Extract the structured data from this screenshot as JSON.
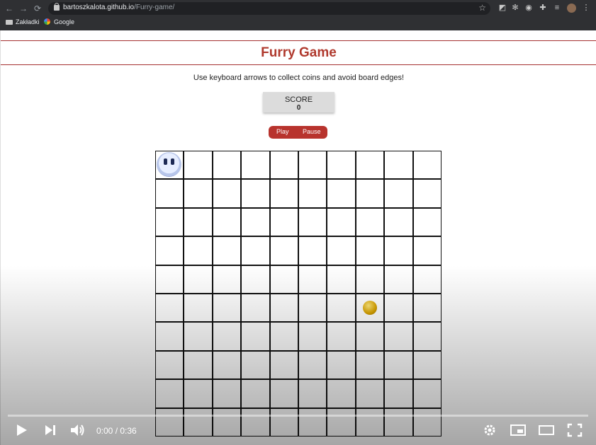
{
  "browser": {
    "url_host": "bartoszkalota.github.io",
    "url_path": "/Furry-game/",
    "bookmarks": [
      "Zakładki",
      "Google"
    ]
  },
  "page": {
    "title": "Furry Game",
    "instructions": "Use keyboard arrows to collect coins and avoid board edges!",
    "score": {
      "label": "SCORE",
      "value": "0"
    },
    "buttons": {
      "play": "Play",
      "pause": "Pause"
    },
    "accent_color": "#b03a2e",
    "board": {
      "cols": 10,
      "visible_rows": 10,
      "fury_cell": [
        0,
        0
      ],
      "coin_cell": [
        7,
        5
      ]
    }
  },
  "video": {
    "time": "0:00 / 0:36",
    "progress": 0
  }
}
